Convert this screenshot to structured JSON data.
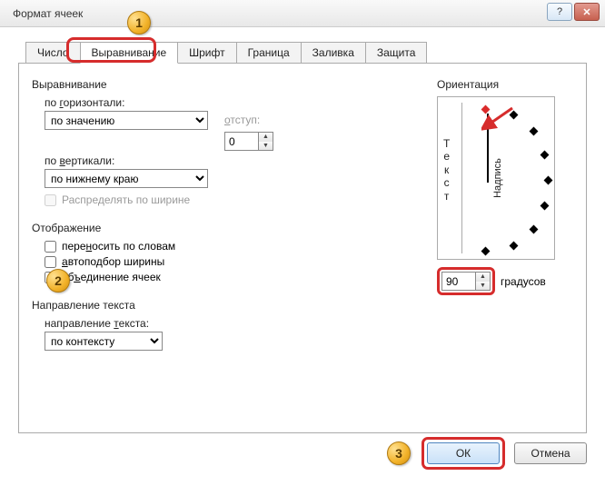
{
  "title": "Формат ячеек",
  "titlebar": {
    "help": "?",
    "close": "✕"
  },
  "tabs": {
    "number": "Число",
    "alignment": "Выравнивание",
    "font": "Шрифт",
    "border": "Граница",
    "fill": "Заливка",
    "protection": "Защита"
  },
  "alignment": {
    "group": "Выравнивание",
    "horizontal_label": "по горизонтали:",
    "horizontal_value": "по значению",
    "indent_label": "отступ:",
    "indent_value": "0",
    "vertical_label": "по вертикали:",
    "vertical_value": "по нижнему краю",
    "distribute": "Распределять по ширине"
  },
  "display": {
    "group": "Отображение",
    "wrap": "переносить по словам",
    "autofit": "автоподбор ширины",
    "merge": "объединение ячеек"
  },
  "direction": {
    "group": "Направление текста",
    "label": "направление текста:",
    "value": "по контексту"
  },
  "orientation": {
    "group": "Ориентация",
    "vertical_text": "Текст",
    "needle_label": "Надпись",
    "degrees_value": "90",
    "degrees_label": "градусов"
  },
  "buttons": {
    "ok": "ОК",
    "cancel": "Отмена"
  },
  "callouts": {
    "c1": "1",
    "c2": "2",
    "c3": "3"
  }
}
